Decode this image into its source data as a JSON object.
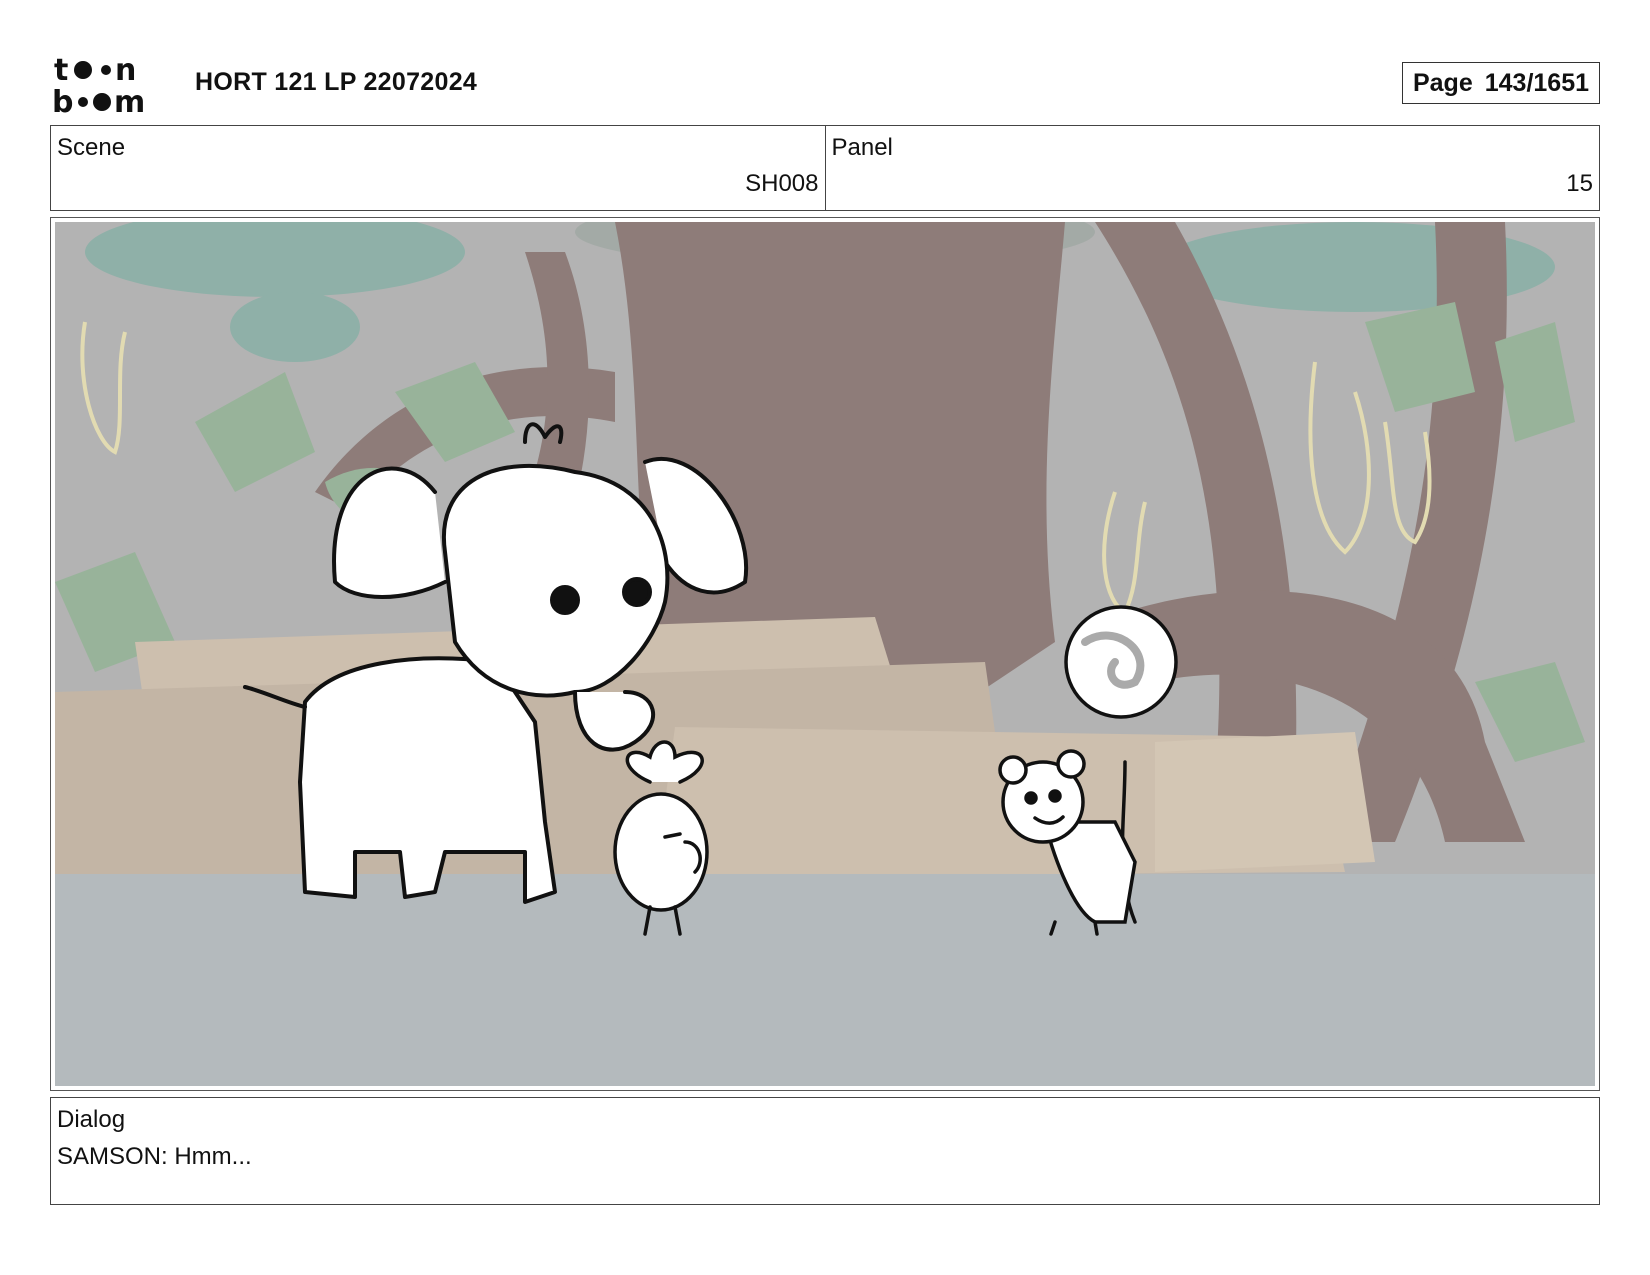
{
  "header": {
    "logo_text": "toonboom",
    "project_title": "HORT 121 LP 22072024",
    "page_label": "Page",
    "page_number": "143/1651"
  },
  "info": {
    "scene_label": "Scene",
    "scene_value": "SH008",
    "panel_label": "Panel",
    "panel_value": "15"
  },
  "panel_image": {
    "characters": [
      "elephant",
      "small-onion-character",
      "bear-cub-with-balloon"
    ],
    "colors": {
      "sky": "#b3b3b3",
      "ground": "#b4babd",
      "trunk": "#8e7c79",
      "foliage": "#8fb0a8",
      "leaves": "#98b39a",
      "rock": "#cdbfae"
    }
  },
  "dialog": {
    "label": "Dialog",
    "text": "SAMSON: Hmm..."
  }
}
